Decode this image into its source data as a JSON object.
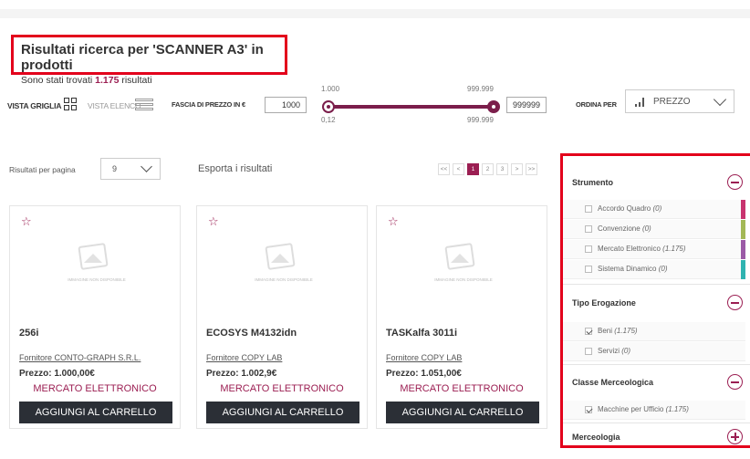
{
  "header": {
    "title": "Risultati ricerca per 'SCANNER A3' in prodotti",
    "found_prefix": "Sono stati trovati",
    "found_count": "1.175",
    "found_suffix": "risultati"
  },
  "viewbar": {
    "grid_label": "VISTA GRIGLIA",
    "list_label": "VISTA ELENCO",
    "price_label": "FASCIA DI PREZZO IN €",
    "price_min": "1000",
    "price_max": "999999",
    "slider_top_left": "1.000",
    "slider_top_right": "999.999",
    "slider_bottom_left": "0,12",
    "slider_bottom_right": "999.999",
    "slider_low_fraction": 0.0,
    "slider_high_fraction": 1.0,
    "sort_label": "ORDINA PER",
    "sort_value": "PREZZO"
  },
  "toolbar": {
    "per_page_label": "Risultati per pagina",
    "per_page_value": "9",
    "export_label": "Esporta i risultati",
    "pager": [
      "<<",
      "<",
      "1",
      "2",
      "3",
      ">",
      ">>"
    ],
    "active_page": "1"
  },
  "products": [
    {
      "title": "256i",
      "supplier": "Fornitore CONTO-GRAPH S.R.L.",
      "price": "Prezzo: 1.000,00€",
      "market": "MERCATO ELETTRONICO",
      "cart": "AGGIUNGI AL CARRELLO",
      "image_caption": "IMMAGINE NON DISPONIBILE"
    },
    {
      "title": "ECOSYS M4132idn",
      "supplier": "Fornitore COPY LAB",
      "price": "Prezzo: 1.002,9€",
      "market": "MERCATO ELETTRONICO",
      "cart": "AGGIUNGI AL CARRELLO",
      "image_caption": "IMMAGINE NON DISPONIBILE"
    },
    {
      "title": "TASKalfa 3011i",
      "supplier": "Fornitore COPY LAB",
      "price": "Prezzo: 1.051,00€",
      "market": "MERCATO ELETTRONICO",
      "cart": "AGGIUNGI AL CARRELLO",
      "image_caption": "IMMAGINE NON DISPONIBILE"
    }
  ],
  "filters": {
    "strumento": {
      "title": "Strumento",
      "items": [
        {
          "label": "Accordo Quadro",
          "count": "(0)",
          "color": "#c8336e"
        },
        {
          "label": "Convenzione",
          "count": "(0)",
          "color": "#a3b856"
        },
        {
          "label": "Mercato Elettronico",
          "count": "(1.175)",
          "color": "#9b5aa6"
        },
        {
          "label": "Sistema Dinamico",
          "count": "(0)",
          "color": "#2fb3b0"
        }
      ]
    },
    "tipo": {
      "title": "Tipo Erogazione",
      "items": [
        {
          "label": "Beni",
          "count": "(1.175)",
          "checked": true
        },
        {
          "label": "Servizi",
          "count": "(0)",
          "checked": false
        }
      ]
    },
    "classe": {
      "title": "Classe Merceologica",
      "items": [
        {
          "label": "Macchine per Ufficio",
          "count": "(1.175)",
          "checked": true
        }
      ]
    },
    "merceologia": {
      "title": "Merceologia"
    }
  },
  "colors": {
    "accent": "#9b1e52",
    "highlight_border": "#e3001b",
    "button_dark": "#2b2f36"
  }
}
